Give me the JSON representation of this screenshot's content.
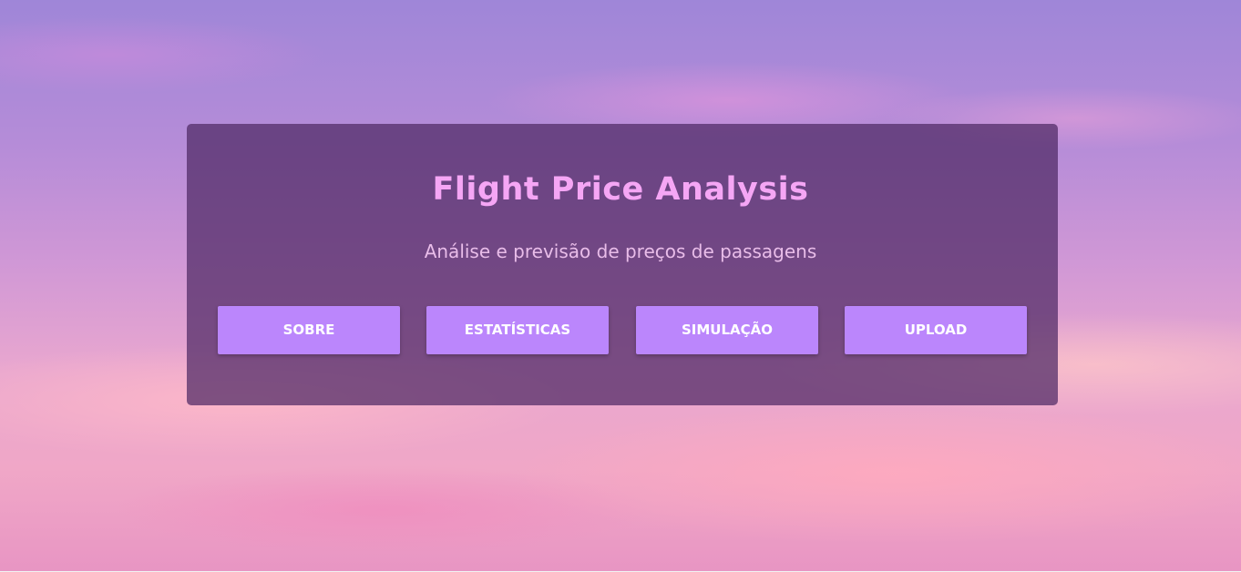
{
  "header": {
    "title": "Flight Price Analysis",
    "subtitle": "Análise e previsão de preços de passagens"
  },
  "nav": {
    "buttons": [
      {
        "label": "SOBRE"
      },
      {
        "label": "ESTATÍSTICAS"
      },
      {
        "label": "SIMULAÇÃO"
      },
      {
        "label": "UPLOAD"
      }
    ]
  },
  "colors": {
    "card_bg": "#4e2864",
    "title": "#f5a6f5",
    "subtitle": "#e9bde9",
    "button_bg": "#bb86fc",
    "button_text": "#ffffff"
  }
}
